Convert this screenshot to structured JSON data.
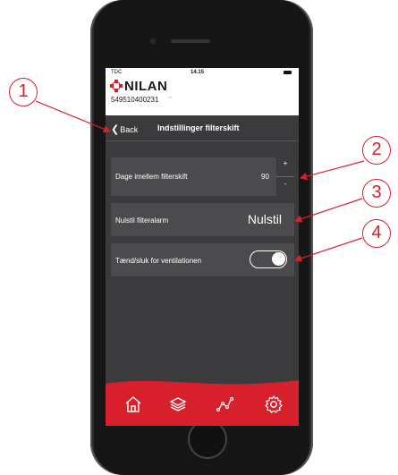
{
  "status_bar": {
    "carrier": "TDC",
    "time": "14.15"
  },
  "header": {
    "brand": "NILAN",
    "serial": "549510400231"
  },
  "nav": {
    "back_label": "Back",
    "title": "Indstillinger filterskift"
  },
  "settings": {
    "filter_days": {
      "label": "Dage imellem filterskift",
      "value": "90",
      "plus": "+",
      "minus": "-"
    },
    "reset_alarm": {
      "label": "Nulstil filteralarm",
      "button_label": "Nulstil"
    },
    "ventilation": {
      "label": "Tænd/sluk for ventilationen",
      "state": "on"
    }
  },
  "tabbar": {
    "items": [
      "home-icon",
      "layers-icon",
      "chart-icon",
      "gear-icon"
    ]
  },
  "callouts": [
    "1",
    "2",
    "3",
    "4"
  ],
  "colors": {
    "accent": "#d8202c",
    "screen_bg": "#3b3b3e",
    "card_bg": "#4b4b4e",
    "toggle_on": "#ffffff"
  }
}
